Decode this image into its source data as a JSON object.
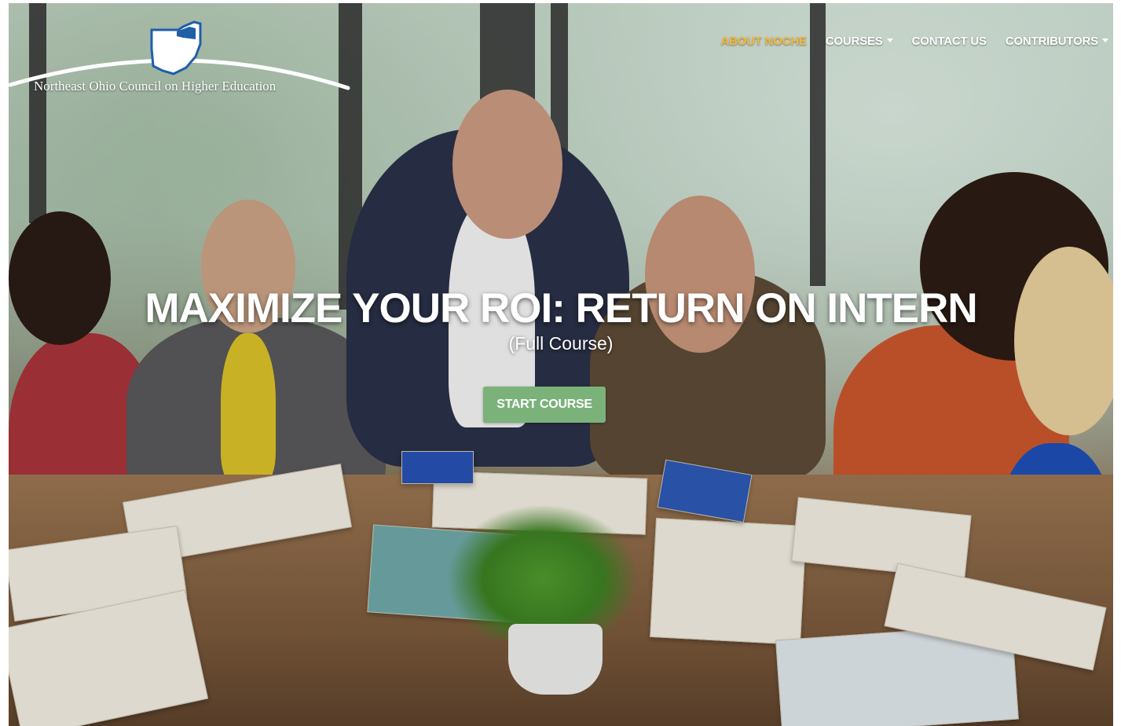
{
  "header": {
    "logo_text": "Northeast Ohio Council on Higher Education",
    "logo_icon": "ohio-state-outline-icon"
  },
  "nav": {
    "items": [
      {
        "label": "ABOUT NOCHE",
        "active": true,
        "dropdown": false
      },
      {
        "label": "COURSES",
        "active": false,
        "dropdown": true
      },
      {
        "label": "CONTACT US",
        "active": false,
        "dropdown": false
      },
      {
        "label": "CONTRIBUTORS",
        "active": false,
        "dropdown": true
      }
    ]
  },
  "hero": {
    "title": "MAXIMIZE YOUR ROI: RETURN ON INTERN",
    "subtitle": "(Full Course)",
    "button_label": "START COURSE"
  },
  "colors": {
    "nav_active": "#f2b83c",
    "button_bg": "#7bb27a",
    "text": "#ffffff",
    "logo_blue": "#1f5fa8"
  }
}
